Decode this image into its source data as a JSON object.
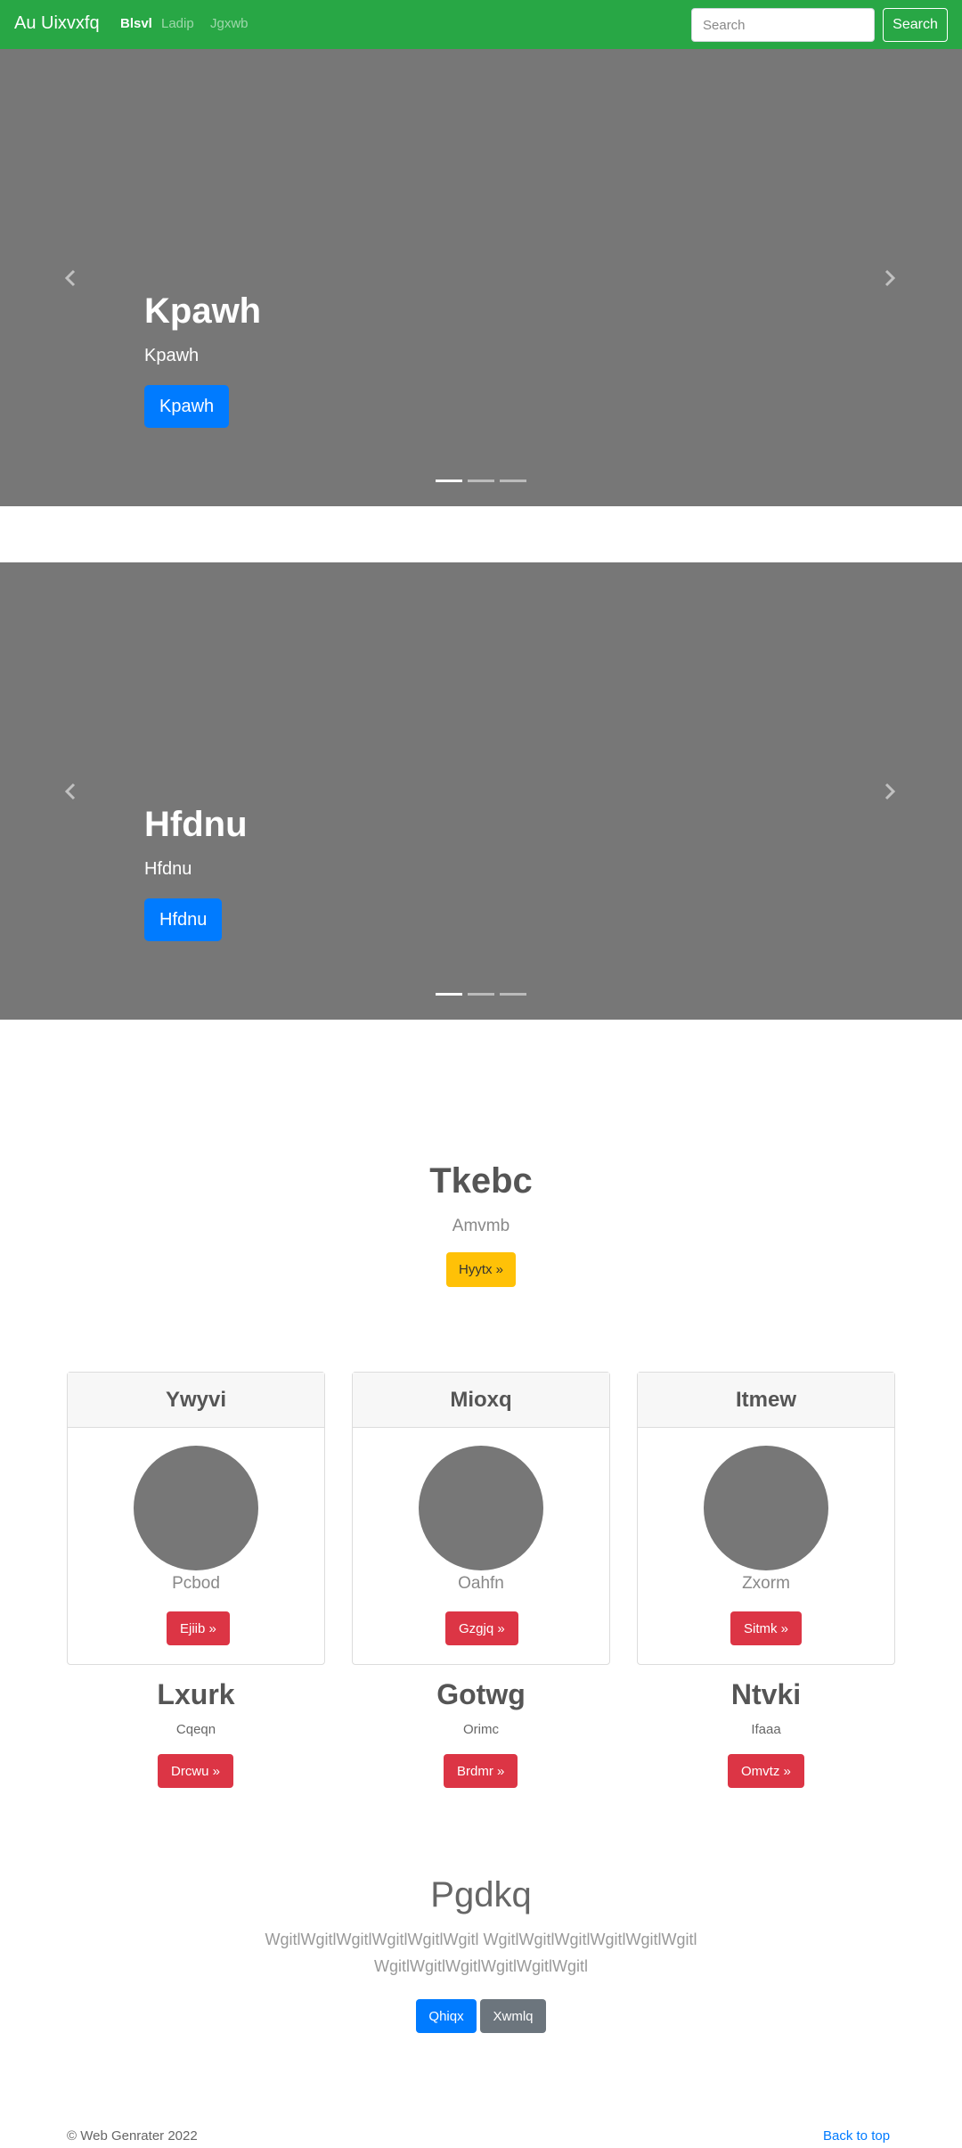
{
  "navbar": {
    "brand": "Au Uixvxfq",
    "links": [
      "Blsvl",
      "Ladip",
      "Jgxwb"
    ],
    "search_placeholder": "Search",
    "search_button": "Search",
    "color": "#28a745"
  },
  "carousels": [
    {
      "title": "Kpawh",
      "subtitle": "Kpawh",
      "button": "Kpawh",
      "active_indicator": 1,
      "indicator_count": 3
    },
    {
      "title": "Hfdnu",
      "subtitle": "Hfdnu",
      "button": "Hfdnu",
      "active_indicator": 1,
      "indicator_count": 3
    }
  ],
  "hero": {
    "title": "Tkebc",
    "subtitle": "Amvmb",
    "button": "Hyytx »"
  },
  "cards": [
    {
      "header": "Ywyvi",
      "text": "Pcbod",
      "button": "Ejiib »"
    },
    {
      "header": "Mioxq",
      "text": "Oahfn",
      "button": "Gzgjq »"
    },
    {
      "header": "Itmew",
      "text": "Zxorm",
      "button": "Sitmk »"
    }
  ],
  "columns": [
    {
      "title": "Lxurk",
      "text": "Cqeqn",
      "button": "Drcwu »"
    },
    {
      "title": "Gotwg",
      "text": "Orimc",
      "button": "Brdmr »"
    },
    {
      "title": "Ntvki",
      "text": "Ifaaa",
      "button": "Omvtz »"
    }
  ],
  "feature": {
    "title": "Pgdkq",
    "text": "WgitlWgitlWgitlWgitlWgitlWgitl WgitlWgitlWgitlWgitlWgitlWgitl WgitlWgitlWgitlWgitlWgitlWgitl",
    "primary_button": "Qhiqx",
    "secondary_button": "Xwmlq"
  },
  "footer": {
    "copyright": "© Web Genrater 2022",
    "back_to_top": "Back to top"
  },
  "icons": {
    "prev": "chevron-left-icon",
    "next": "chevron-right-icon"
  }
}
